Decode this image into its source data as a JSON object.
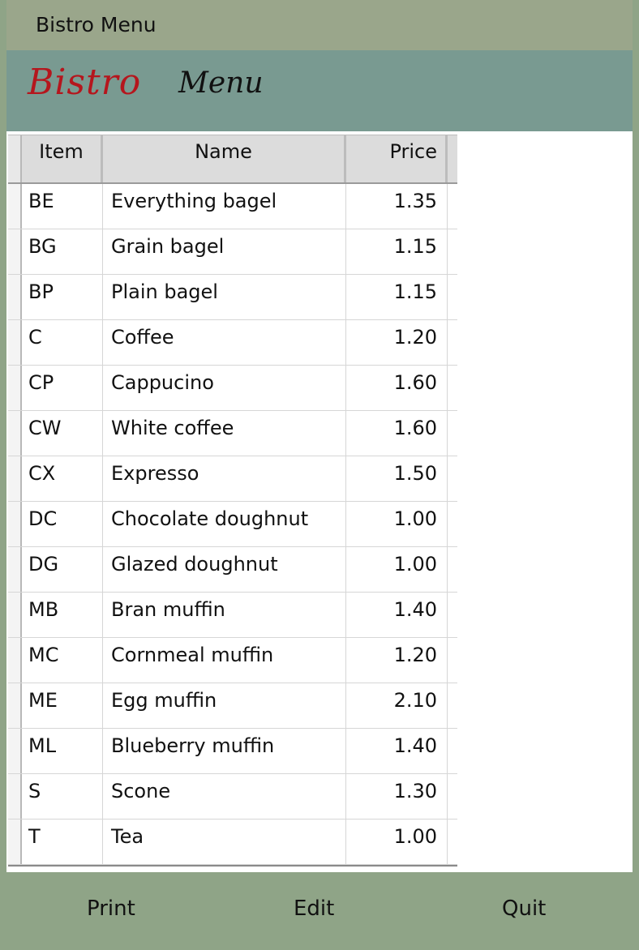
{
  "window": {
    "title": "Bistro Menu"
  },
  "banner": {
    "word1": "Bistro",
    "word2": "Menu"
  },
  "table": {
    "columns": [
      "Item",
      "Name",
      "Price"
    ],
    "rows": [
      {
        "item": "BE",
        "name": "Everything bagel",
        "price": "1.35"
      },
      {
        "item": "BG",
        "name": "Grain bagel",
        "price": "1.15"
      },
      {
        "item": "BP",
        "name": "Plain bagel",
        "price": "1.15"
      },
      {
        "item": "C",
        "name": "Coffee",
        "price": "1.20"
      },
      {
        "item": "CP",
        "name": "Cappucino",
        "price": "1.60"
      },
      {
        "item": "CW",
        "name": "White coffee",
        "price": "1.60"
      },
      {
        "item": "CX",
        "name": "Expresso",
        "price": "1.50"
      },
      {
        "item": "DC",
        "name": "Chocolate doughnut",
        "price": "1.00"
      },
      {
        "item": "DG",
        "name": "Glazed doughnut",
        "price": "1.00"
      },
      {
        "item": "MB",
        "name": "Bran muffin",
        "price": "1.40"
      },
      {
        "item": "MC",
        "name": "Cornmeal muffin",
        "price": "1.20"
      },
      {
        "item": "ME",
        "name": "Egg muffin",
        "price": "2.10"
      },
      {
        "item": "ML",
        "name": "Blueberry muffin",
        "price": "1.40"
      },
      {
        "item": "S",
        "name": "Scone",
        "price": "1.30"
      },
      {
        "item": "T",
        "name": "Tea",
        "price": "1.00"
      }
    ]
  },
  "footer": {
    "print_label": "Print",
    "edit_label": "Edit",
    "quit_label": "Quit"
  },
  "colors": {
    "window_frame": "#8fa487",
    "titlebar": "#9aa68b",
    "banner_bg": "#799a91",
    "banner_accent": "#b5161d"
  }
}
